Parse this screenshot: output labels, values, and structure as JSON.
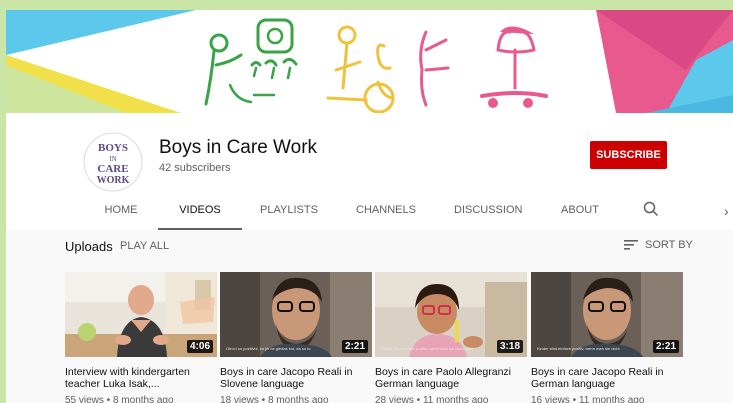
{
  "channel": {
    "name": "Boys in Care Work",
    "subscribers": "42 subscribers",
    "subscribe_label": "SUBSCRIBE",
    "avatar_icon": "boys-in-care-work-logo"
  },
  "tabs": [
    "HOME",
    "VIDEOS",
    "PLAYLISTS",
    "CHANNELS",
    "DISCUSSION",
    "ABOUT"
  ],
  "active_tab": "VIDEOS",
  "uploads": {
    "title": "Uploads",
    "play_all": "PLAY ALL",
    "sort_by": "SORT BY"
  },
  "videos": [
    {
      "title": "Interview with kindergarten teacher Luka Isak,...",
      "duration": "4:06",
      "meta": "55 views • 8 months ago",
      "caption": ""
    },
    {
      "title": "Boys in care Jacopo Reali in Slovene language",
      "duration": "2:21",
      "meta": "18 views • 8 months ago",
      "caption": "Otroci so pozitivni, ko jih ne gledas kot, da so to"
    },
    {
      "title": "Boys in care Paolo Allegranzi German language",
      "duration": "3:18",
      "meta": "28 views • 11 months ago",
      "caption": "Kinder sind einfach positiv, wenn man sie nicht sieht"
    },
    {
      "title": "Boys in care Jacopo Reali in German language",
      "duration": "2:21",
      "meta": "16 views • 11 months ago",
      "caption": "Kinder sind einfach positiv, wenn man sie nicht"
    }
  ],
  "colors": {
    "page_bg": "#c9e6a6",
    "subscribe": "#cc0000",
    "banner_yellow": "#f2e04a",
    "banner_cyan": "#5cc8ec",
    "banner_pink": "#e85a8e",
    "banner_green": "#3aa348"
  },
  "icons": {
    "search": "search-icon",
    "sort": "sort-icon",
    "next": "chevron-right-icon"
  }
}
